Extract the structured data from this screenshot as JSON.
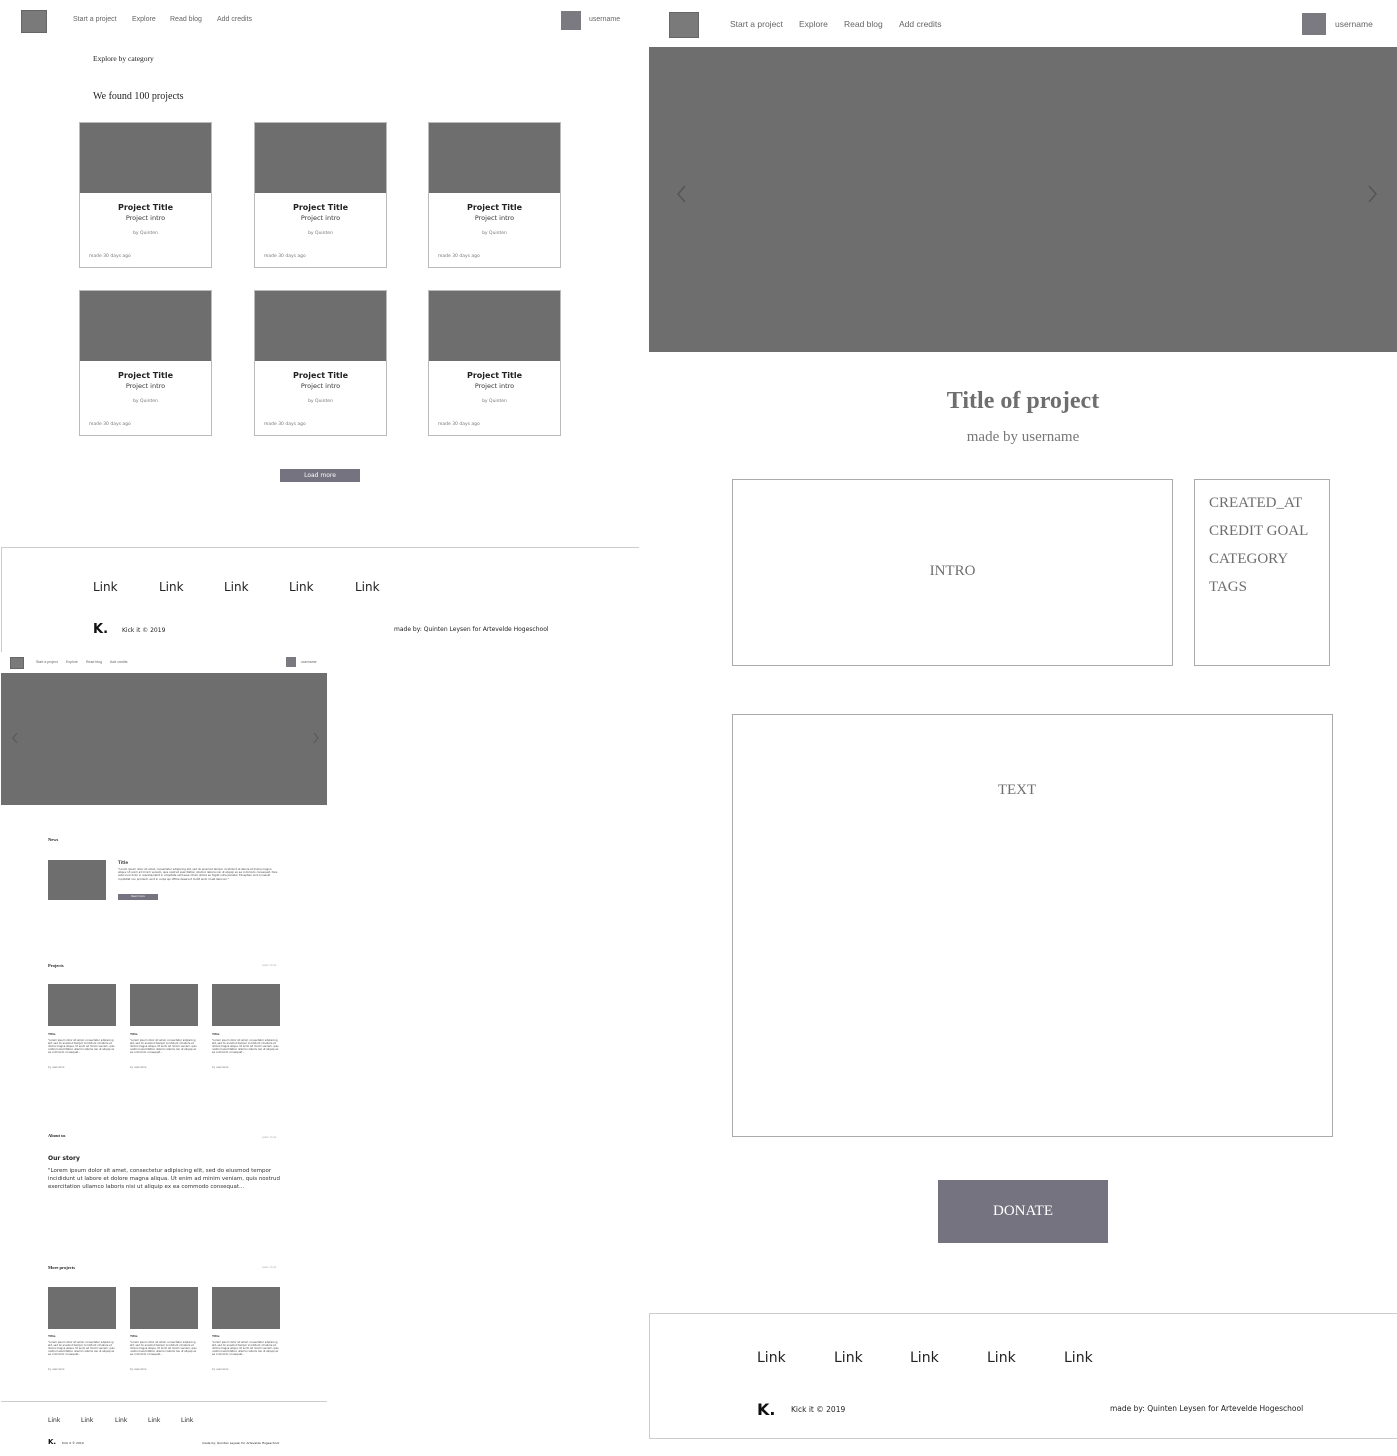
{
  "nav": {
    "links": [
      "Start a project",
      "Explore",
      "Read blog",
      "Add credits"
    ],
    "small_links": [
      "Start a project",
      "Explore",
      "Read blog",
      "Add credits"
    ],
    "username": "username"
  },
  "explore": {
    "category_label": "Explore by category",
    "results_heading": "We found 100 projects",
    "cards": [
      {
        "title": "Project Title",
        "intro": "Project intro",
        "by": "by Quinten",
        "meta": "made 30 days ago"
      },
      {
        "title": "Project Title",
        "intro": "Project intro",
        "by": "by Quinten",
        "meta": "made 30 days ago"
      },
      {
        "title": "Project Title",
        "intro": "Project intro",
        "by": "by Quinten",
        "meta": "made 30 days ago"
      },
      {
        "title": "Project Title",
        "intro": "Project intro",
        "by": "by Quinten",
        "meta": "made 30 days ago"
      },
      {
        "title": "Project Title",
        "intro": "Project intro",
        "by": "by Quinten",
        "meta": "made 30 days ago"
      },
      {
        "title": "Project Title",
        "intro": "Project intro",
        "by": "by Quinten",
        "meta": "made 30 days ago"
      }
    ],
    "load_more": "Load more"
  },
  "footer": {
    "links": [
      "Link",
      "Link",
      "Link",
      "Link",
      "Link"
    ],
    "logo": "K.",
    "copyright": "Kick it  ©  2019",
    "credit": "made by: Quinten Leysen for Artevelde Hogeschool"
  },
  "home": {
    "news_heading": "News",
    "news_title": "Title",
    "news_text": "\"Lorem ipsum dolor sit amet, consectetur adipiscing elit, sed do eiusmod tempor incididunt ut labore et dolore magna aliqua. Ut enim ad minim veniam, quis nostrud exercitation ullamco laboris nisi ut aliquip ex ea commodo consequat. Duis aute irure dolor in reprehenderit in voluptate velit esse cillum dolore eu fugiat nulla pariatur. Excepteur sint occaecat cupidatat non proident, sunt in culpa qui officia deserunt mollit anim id est laborum.\"",
    "read_more": "Read more",
    "projects_heading": "Projects",
    "see_more": "Learn more",
    "project_cards": [
      {
        "title": "Title",
        "text": "\"Lorem ipsum dolor sit amet, consectetur adipiscing elit, sed do eiusmod tempor incididunt ut labore et dolore magna aliqua. Ut enim ad minim veniam, quis nostrud exercitation ullamco laboris nisi ut aliquip ex ea commodo consequat...",
        "by": "by username"
      },
      {
        "title": "Title",
        "text": "\"Lorem ipsum dolor sit amet, consectetur adipiscing elit, sed do eiusmod tempor incididunt ut labore et dolore magna aliqua. Ut enim ad minim veniam, quis nostrud exercitation ullamco laboris nisi ut aliquip ex ea commodo consequat...",
        "by": "by username"
      },
      {
        "title": "Title",
        "text": "\"Lorem ipsum dolor sit amet, consectetur adipiscing elit, sed do eiusmod tempor incididunt ut labore et dolore magna aliqua. Ut enim ad minim veniam, quis nostrud exercitation ullamco laboris nisi ut aliquip ex ea commodo consequat...",
        "by": "by username"
      }
    ],
    "about_heading": "About us",
    "about_title": "Our story",
    "about_text": "\"Lorem ipsum dolor sit amet, consectetur adipiscing elit, sed do eiusmod tempor incididunt ut labore et dolore magna aliqua. Ut enim ad minim veniam, quis nostrud exercitation ullamco laboris nisi ut aliquip ex ea commodo consequat...",
    "more_heading": "More projects"
  },
  "detail": {
    "title": "Title of project",
    "subtitle": "made by username",
    "intro": "INTRO",
    "meta": [
      "CREATED_AT",
      "CREDIT GOAL",
      "CATEGORY",
      "TAGS"
    ],
    "text": "TEXT",
    "donate": "DONATE"
  },
  "icons": {
    "prev": "chevron-left-icon",
    "next": "chevron-right-icon"
  },
  "colors": {
    "placeholder": "#6e6e6e",
    "button": "#74737f",
    "border": "#bbbbbb"
  }
}
